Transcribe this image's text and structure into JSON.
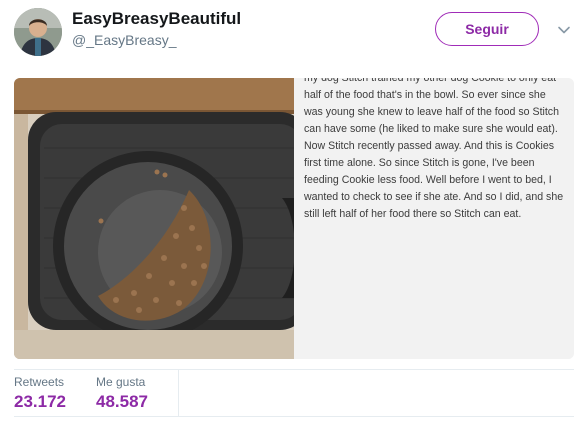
{
  "tweet": {
    "display_name": "EasyBreasyBeautiful",
    "handle": "@_EasyBreasy_",
    "follow_label": "Seguir",
    "note_text": "my dog Stitch trained my other dog Cookie to only eat half of the food that's in the bowl. So ever since she was young she knew to leave half of the food so Stitch can have some (he liked to make sure she would eat). Now Stitch recently passed away. And this is Cookies first time alone. So since Stitch is gone, I've been feeding Cookie less food. Well before I went to bed, I wanted to check to see if she ate. And so I did, and she still left half of her food there so Stitch can eat."
  },
  "stats": {
    "retweets_label": "Retweets",
    "retweets_value": "23.172",
    "likes_label": "Me gusta",
    "likes_value": "48.587"
  },
  "colors": {
    "accent": "#8d2aa6",
    "follow_border": "#a02cb8",
    "muted_text": "#657786",
    "note_bg": "#f2f2f2"
  },
  "icons": {
    "more_menu": "chevron-down-icon"
  }
}
